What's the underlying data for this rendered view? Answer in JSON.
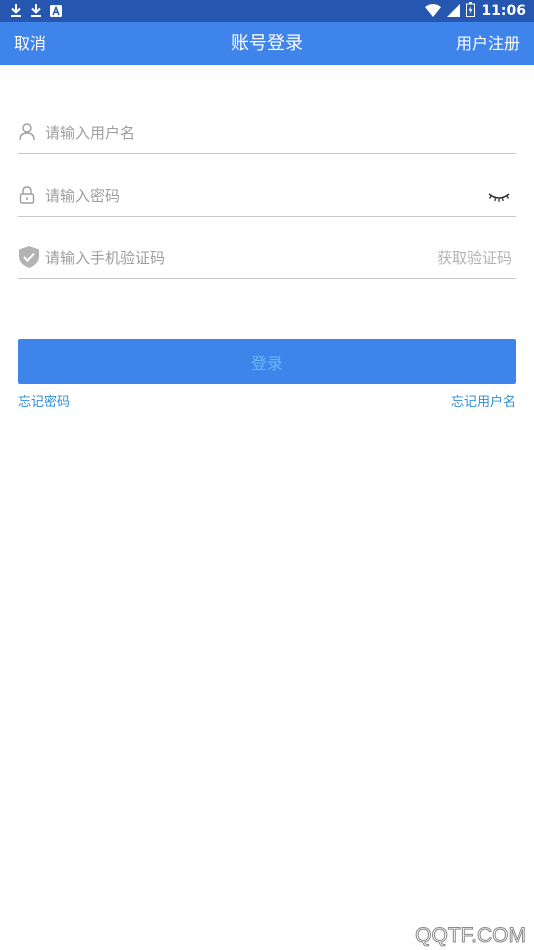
{
  "status_bar": {
    "time": "11:06",
    "left_icons": [
      "download-icon",
      "download-icon",
      "notification-a-icon"
    ],
    "right_icons": [
      "wifi-icon",
      "signal-icon",
      "battery-icon"
    ]
  },
  "app_bar": {
    "cancel_label": "取消",
    "title": "账号登录",
    "register_label": "用户注册",
    "background": "#3f84ea"
  },
  "form": {
    "username": {
      "placeholder": "请输入用户名",
      "value": "",
      "icon": "user-icon"
    },
    "password": {
      "placeholder": "请输入密码",
      "value": "",
      "icon": "lock-icon",
      "toggle_icon": "eye-closed-icon"
    },
    "sms_code": {
      "placeholder": "请输入手机验证码",
      "value": "",
      "icon": "shield-check-icon",
      "get_code_label": "获取验证码"
    }
  },
  "login_button": {
    "label": "登录"
  },
  "links": {
    "forgot_password": "忘记密码",
    "forgot_username": "忘记用户名"
  },
  "watermark": "QQTF.COM",
  "colors": {
    "status_bar": "#2556b0",
    "accent": "#3f84ea",
    "link": "#2f8fd8",
    "placeholder": "#9e9e9e"
  }
}
